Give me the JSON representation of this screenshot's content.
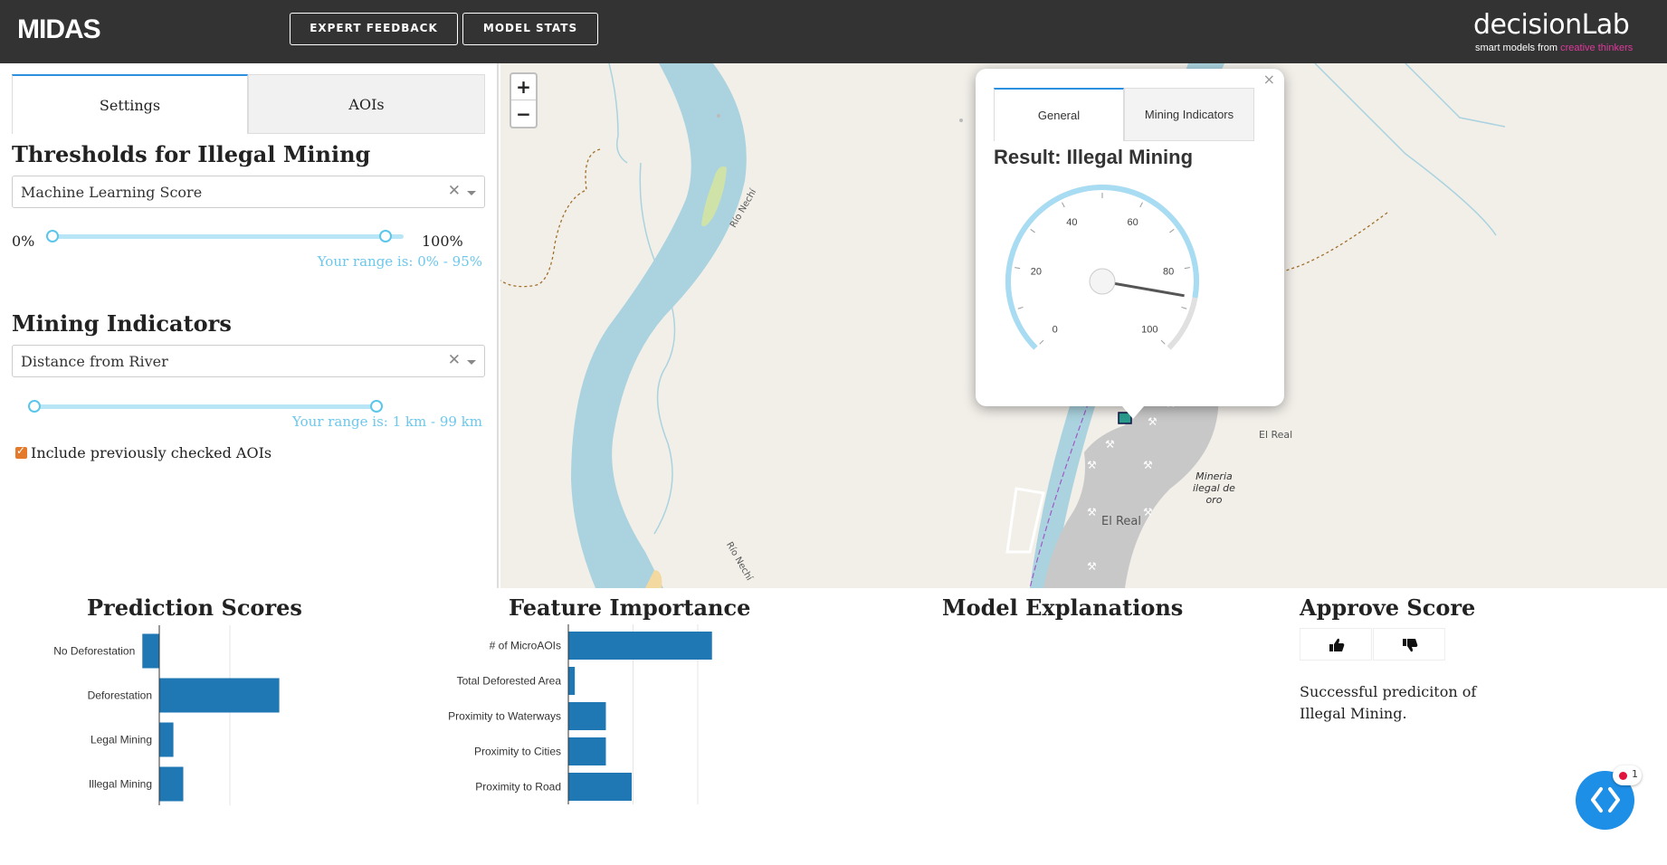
{
  "header": {
    "logo": "MIDAS",
    "buttons": {
      "expert_feedback": "EXPERT FEEDBACK",
      "model_stats": "MODEL STATS"
    },
    "brand": "decisionLab",
    "tagline_prefix": "smart models from ",
    "tagline_highlight": "creative thinkers",
    "colors": {
      "bar": "#333333",
      "tagline_highlight": "#e0389c"
    }
  },
  "left_panel": {
    "tabs": {
      "settings": "Settings",
      "aois": "AOIs"
    },
    "thresholds": {
      "title": "Thresholds for Illegal Mining",
      "select_value": "Machine Learning Score",
      "min_label": "0%",
      "max_label": "100%",
      "range_note": "Your range is: 0% - 95%",
      "range_low": 0,
      "range_high": 95
    },
    "indicators": {
      "title": "Mining Indicators",
      "select_value": "Distance from River",
      "range_note": "Your range is: 1 km - 99 km",
      "range_low": 1,
      "range_high": 99
    },
    "include_checked": {
      "label": "Include previously checked AOIs",
      "checked": true
    }
  },
  "map": {
    "zoom_in": "+",
    "zoom_out": "−",
    "labels": {
      "river_1": "Río Nechí",
      "river_2": "Río Nechí",
      "town_1": "El Real",
      "town_2": "El Real",
      "mining_area": [
        "Mineria",
        "ilegal de",
        "oro"
      ]
    },
    "popup": {
      "close": "×",
      "tabs": {
        "general": "General",
        "mining": "Mining Indicators"
      },
      "result": "Result: Illegal Mining",
      "gauge": {
        "value": 87,
        "min": 0,
        "max": 100,
        "ticks": [
          "0",
          "20",
          "40",
          "60",
          "80",
          "100"
        ]
      }
    }
  },
  "bottom": {
    "prediction_scores": {
      "title": "Prediction Scores",
      "chart_data": {
        "type": "bar",
        "orientation": "horizontal",
        "categories": [
          "No Deforestation",
          "Deforestation",
          "Legal Mining",
          "Illegal Mining"
        ],
        "values": [
          -12,
          85,
          10,
          17
        ],
        "xticks": [
          "0",
          "50"
        ],
        "color": "#1f77b4"
      }
    },
    "feature_importance": {
      "title": "Feature Importance",
      "chart_data": {
        "type": "bar",
        "orientation": "horizontal",
        "categories": [
          "# of MicroAOIs",
          "Total Deforested Area",
          "Proximity to Waterways",
          "Proximity to Cities",
          "Proximity to Road"
        ],
        "values": [
          111,
          5,
          29,
          29,
          49
        ],
        "xticks": [
          "0",
          "50",
          "100"
        ],
        "color": "#1f77b4"
      }
    },
    "model_explanations": {
      "title": "Model Explanations"
    },
    "approve_score": {
      "title": "Approve Score",
      "thumbs_up_icon": "thumbs-up-icon",
      "thumbs_down_icon": "thumbs-down-icon",
      "message": "Successful prediciton of Illegal Mining."
    }
  },
  "fab": {
    "icon": "code-brackets-icon",
    "badge_count": "1",
    "color": "#1e8fe6"
  }
}
